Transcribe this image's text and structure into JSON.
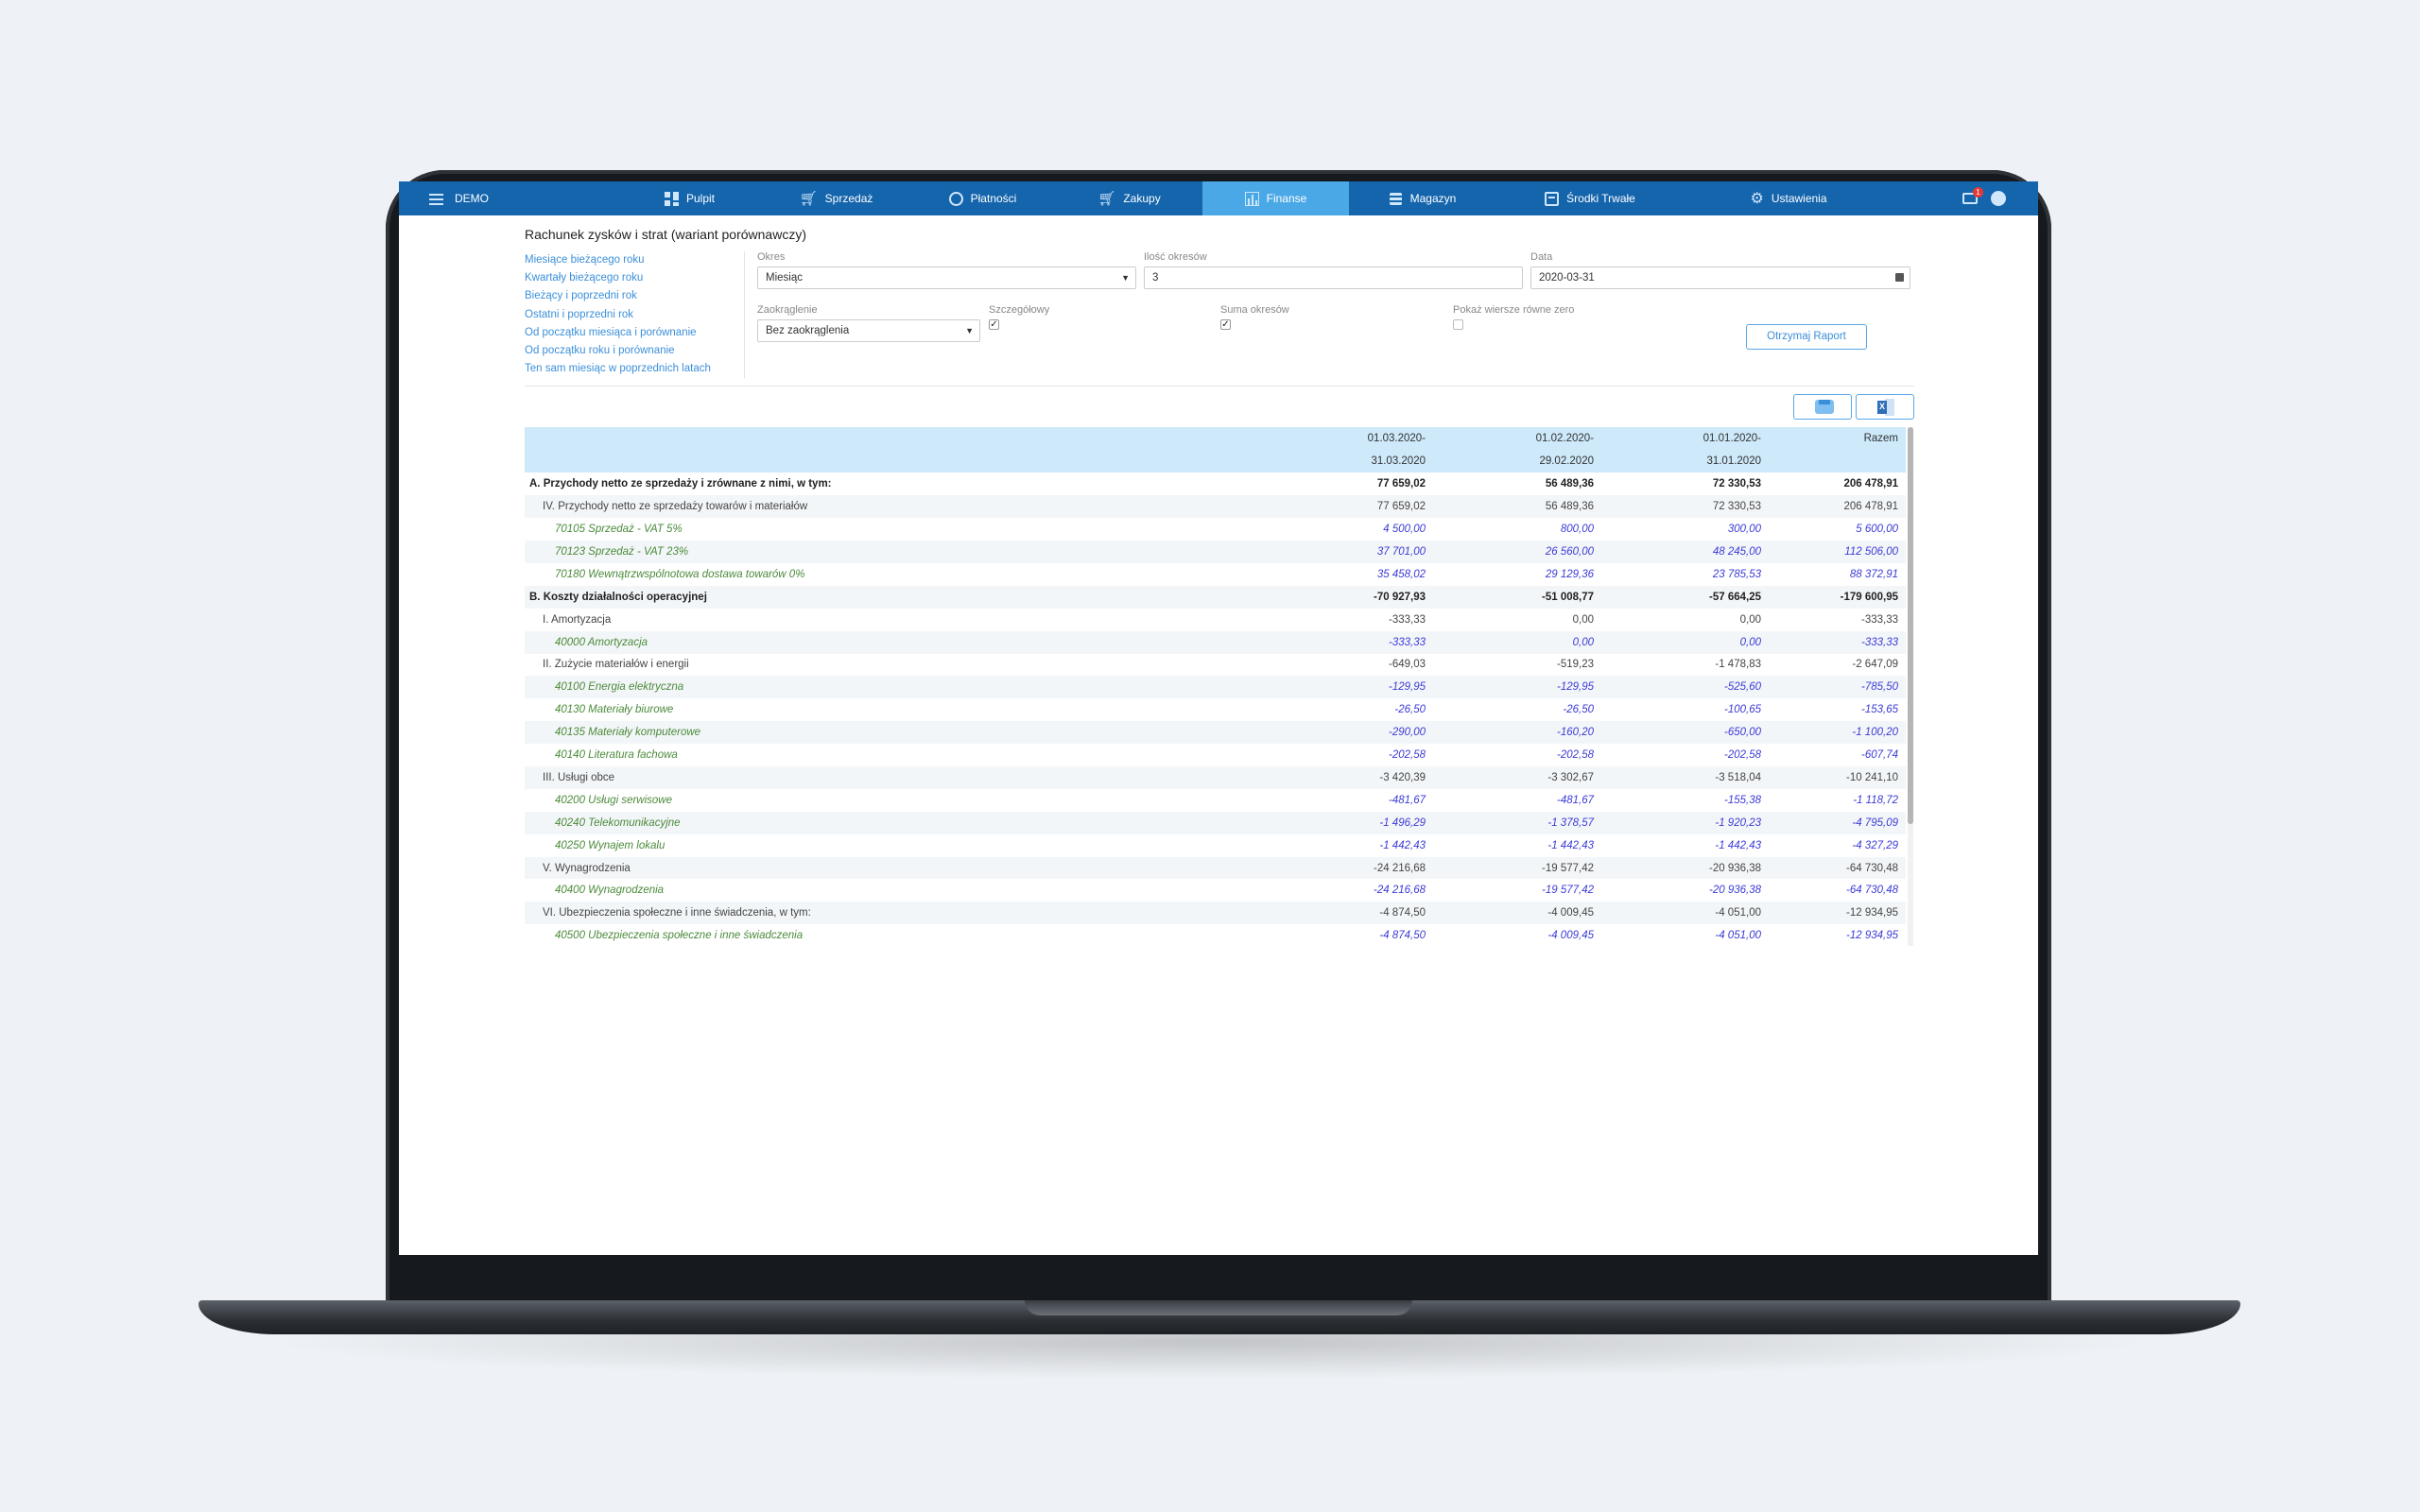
{
  "nav": {
    "brand": "DEMO",
    "items": [
      {
        "label": "Pulpit",
        "icon": "dashboard-icon",
        "active": false
      },
      {
        "label": "Sprzedaż",
        "icon": "cart-icon",
        "active": false
      },
      {
        "label": "Płatności",
        "icon": "payment-icon",
        "active": false
      },
      {
        "label": "Zakupy",
        "icon": "cart-icon",
        "active": false
      },
      {
        "label": "Finanse",
        "icon": "chart-icon",
        "active": true
      },
      {
        "label": "Magazyn",
        "icon": "database-icon",
        "active": false
      },
      {
        "label": "Środki Trwałe",
        "icon": "assets-icon",
        "active": false
      },
      {
        "label": "Ustawienia",
        "icon": "gear-icon",
        "active": false
      }
    ],
    "mail_badge": "1"
  },
  "page": {
    "title": "Rachunek zysków i strat (wariant porównawczy)"
  },
  "quick_links": [
    "Miesiące bieżącego roku",
    "Kwartały bieżącego roku",
    "Bieżący i poprzedni rok",
    "Ostatni i poprzedni rok",
    "Od początku miesiąca i porównanie",
    "Od początku roku i porównanie",
    "Ten sam miesiąc w poprzednich latach"
  ],
  "filters": {
    "okres_label": "Okres",
    "okres_value": "Miesiąc",
    "ilosc_label": "Ilość okresów",
    "ilosc_value": "3",
    "data_label": "Data",
    "data_value": "2020-03-31",
    "zaokraglenie_label": "Zaokrąglenie",
    "zaokraglenie_value": "Bez zaokrąglenia",
    "szczegolowy_label": "Szczegółowy",
    "szczegolowy_checked": true,
    "suma_label": "Suma okresów",
    "suma_checked": true,
    "zero_label": "Pokaż wiersze równe zero",
    "zero_checked": false,
    "report_button": "Otrzymaj Raport"
  },
  "table": {
    "columns": [
      {
        "line1": "",
        "line2": ""
      },
      {
        "line1": "01.03.2020-",
        "line2": "31.03.2020"
      },
      {
        "line1": "01.02.2020-",
        "line2": "29.02.2020"
      },
      {
        "line1": "01.01.2020-",
        "line2": "31.01.2020"
      },
      {
        "line1": "Razem",
        "line2": ""
      }
    ],
    "rows": [
      {
        "level": 0,
        "name": "A. Przychody netto ze sprzedaży i zrównane z nimi, w tym:",
        "v": [
          "77 659,02",
          "56 489,36",
          "72 330,53",
          "206 478,91"
        ]
      },
      {
        "level": 1,
        "name": "IV. Przychody netto ze sprzedaży towarów i materiałów",
        "v": [
          "77 659,02",
          "56 489,36",
          "72 330,53",
          "206 478,91"
        ]
      },
      {
        "level": 2,
        "name": "70105 Sprzedaż - VAT 5%",
        "v": [
          "4 500,00",
          "800,00",
          "300,00",
          "5 600,00"
        ]
      },
      {
        "level": 2,
        "name": "70123 Sprzedaż - VAT 23%",
        "v": [
          "37 701,00",
          "26 560,00",
          "48 245,00",
          "112 506,00"
        ]
      },
      {
        "level": 2,
        "name": "70180 Wewnątrzwspólnotowa dostawa towarów 0%",
        "v": [
          "35 458,02",
          "29 129,36",
          "23 785,53",
          "88 372,91"
        ]
      },
      {
        "level": 0,
        "name": "B. Koszty działalności operacyjnej",
        "v": [
          "-70 927,93",
          "-51 008,77",
          "-57 664,25",
          "-179 600,95"
        ]
      },
      {
        "level": 1,
        "name": "I. Amortyzacja",
        "v": [
          "-333,33",
          "0,00",
          "0,00",
          "-333,33"
        ]
      },
      {
        "level": 2,
        "name": "40000 Amortyzacja",
        "v": [
          "-333,33",
          "0,00",
          "0,00",
          "-333,33"
        ]
      },
      {
        "level": 1,
        "name": "II. Zużycie materiałów i energii",
        "v": [
          "-649,03",
          "-519,23",
          "-1 478,83",
          "-2 647,09"
        ]
      },
      {
        "level": 2,
        "name": "40100 Energia elektryczna",
        "v": [
          "-129,95",
          "-129,95",
          "-525,60",
          "-785,50"
        ]
      },
      {
        "level": 2,
        "name": "40130 Materiały biurowe",
        "v": [
          "-26,50",
          "-26,50",
          "-100,65",
          "-153,65"
        ]
      },
      {
        "level": 2,
        "name": "40135 Materiały komputerowe",
        "v": [
          "-290,00",
          "-160,20",
          "-650,00",
          "-1 100,20"
        ]
      },
      {
        "level": 2,
        "name": "40140 Literatura fachowa",
        "v": [
          "-202,58",
          "-202,58",
          "-202,58",
          "-607,74"
        ]
      },
      {
        "level": 1,
        "name": "III. Usługi obce",
        "v": [
          "-3 420,39",
          "-3 302,67",
          "-3 518,04",
          "-10 241,10"
        ]
      },
      {
        "level": 2,
        "name": "40200 Usługi serwisowe",
        "v": [
          "-481,67",
          "-481,67",
          "-155,38",
          "-1 118,72"
        ]
      },
      {
        "level": 2,
        "name": "40240 Telekomunikacyjne",
        "v": [
          "-1 496,29",
          "-1 378,57",
          "-1 920,23",
          "-4 795,09"
        ]
      },
      {
        "level": 2,
        "name": "40250 Wynajem lokalu",
        "v": [
          "-1 442,43",
          "-1 442,43",
          "-1 442,43",
          "-4 327,29"
        ]
      },
      {
        "level": 1,
        "name": "V. Wynagrodzenia",
        "v": [
          "-24 216,68",
          "-19 577,42",
          "-20 936,38",
          "-64 730,48"
        ]
      },
      {
        "level": 2,
        "name": "40400 Wynagrodzenia",
        "v": [
          "-24 216,68",
          "-19 577,42",
          "-20 936,38",
          "-64 730,48"
        ]
      },
      {
        "level": 1,
        "name": "VI. Ubezpieczenia społeczne i inne świadczenia, w tym:",
        "v": [
          "-4 874,50",
          "-4 009,45",
          "-4 051,00",
          "-12 934,95"
        ]
      },
      {
        "level": 2,
        "name": "40500 Ubezpieczenia społeczne i inne świadczenia",
        "v": [
          "-4 874,50",
          "-4 009,45",
          "-4 051,00",
          "-12 934,95"
        ]
      }
    ]
  }
}
